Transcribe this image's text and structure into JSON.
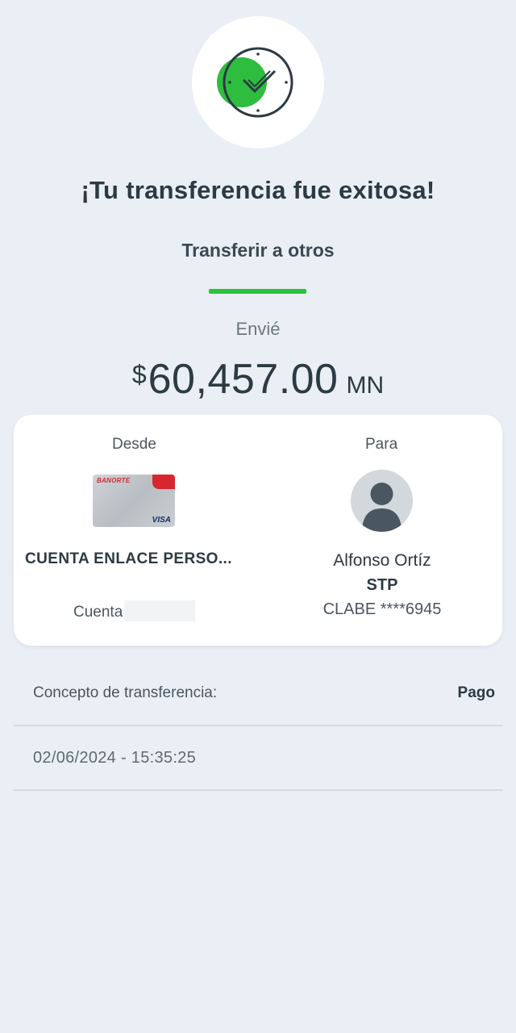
{
  "status": {
    "title": "¡Tu transferencia fue exitosa!",
    "subtitle": "Transferir a otros",
    "icon": "check-clock-icon",
    "accent_color": "#29c43b"
  },
  "amount": {
    "label": "Envié",
    "currency_symbol": "$",
    "value": "60,457.00",
    "unit": "MN"
  },
  "from": {
    "label": "Desde",
    "card_brand": "BANORTE",
    "card_network": "VISA",
    "account_name": "CUENTA ENLACE PERSO...",
    "account_label": "Cuenta"
  },
  "to": {
    "label": "Para",
    "name": "Alfonso Ortíz",
    "bank": "STP",
    "clabe": "CLABE ****6945",
    "avatar_icon": "user-avatar-icon"
  },
  "details": {
    "concept_label": "Concepto de transferencia:",
    "concept_value": "Pago",
    "datetime": "02/06/2024 - 15:35:25"
  }
}
